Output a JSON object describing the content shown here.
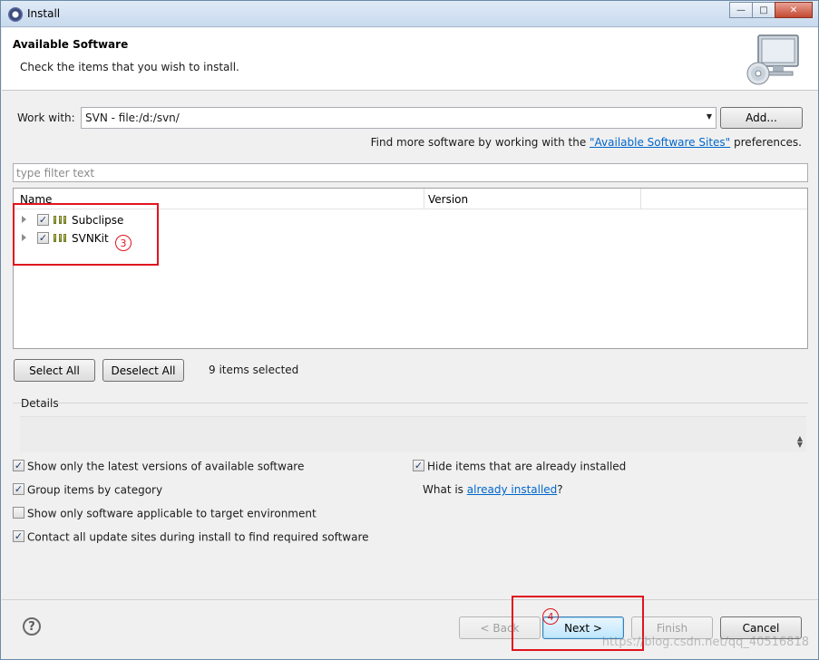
{
  "window": {
    "title": "Install",
    "controls": [
      "minimize",
      "maximize",
      "close"
    ]
  },
  "header": {
    "title": "Available Software",
    "subtitle": "Check the items that you wish to install."
  },
  "work_with": {
    "label": "Work with:",
    "value": "SVN - file:/d:/svn/",
    "add_label": "Add...",
    "find_prefix": "Find more software by working with the ",
    "find_link": "\"Available Software Sites\"",
    "find_suffix": " preferences."
  },
  "filter": {
    "placeholder": "type filter text"
  },
  "tree": {
    "columns": [
      "Name",
      "Version"
    ],
    "items": [
      {
        "label": "Subclipse",
        "checked": true
      },
      {
        "label": "SVNKit",
        "checked": true
      }
    ]
  },
  "selection": {
    "select_all": "Select All",
    "deselect_all": "Deselect All",
    "count_text": "9 items selected"
  },
  "details": {
    "label": "Details"
  },
  "options": {
    "latest": "Show only the latest versions of available software",
    "group": "Group items by category",
    "applicable": "Show only software applicable to target environment",
    "contact": "Contact all update sites during install to find required software",
    "hide_installed": "Hide items that are already installed",
    "what_is_prefix": "What is ",
    "what_is_link": "already installed",
    "what_is_suffix": "?"
  },
  "options_checked": {
    "latest": true,
    "group": true,
    "applicable": false,
    "contact": true,
    "hide_installed": true
  },
  "footer": {
    "back": "< Back",
    "next": "Next >",
    "finish": "Finish",
    "cancel": "Cancel"
  },
  "annotations": {
    "step3": "3",
    "step4": "4"
  },
  "watermark": "https://blog.csdn.net/qq_40516818"
}
